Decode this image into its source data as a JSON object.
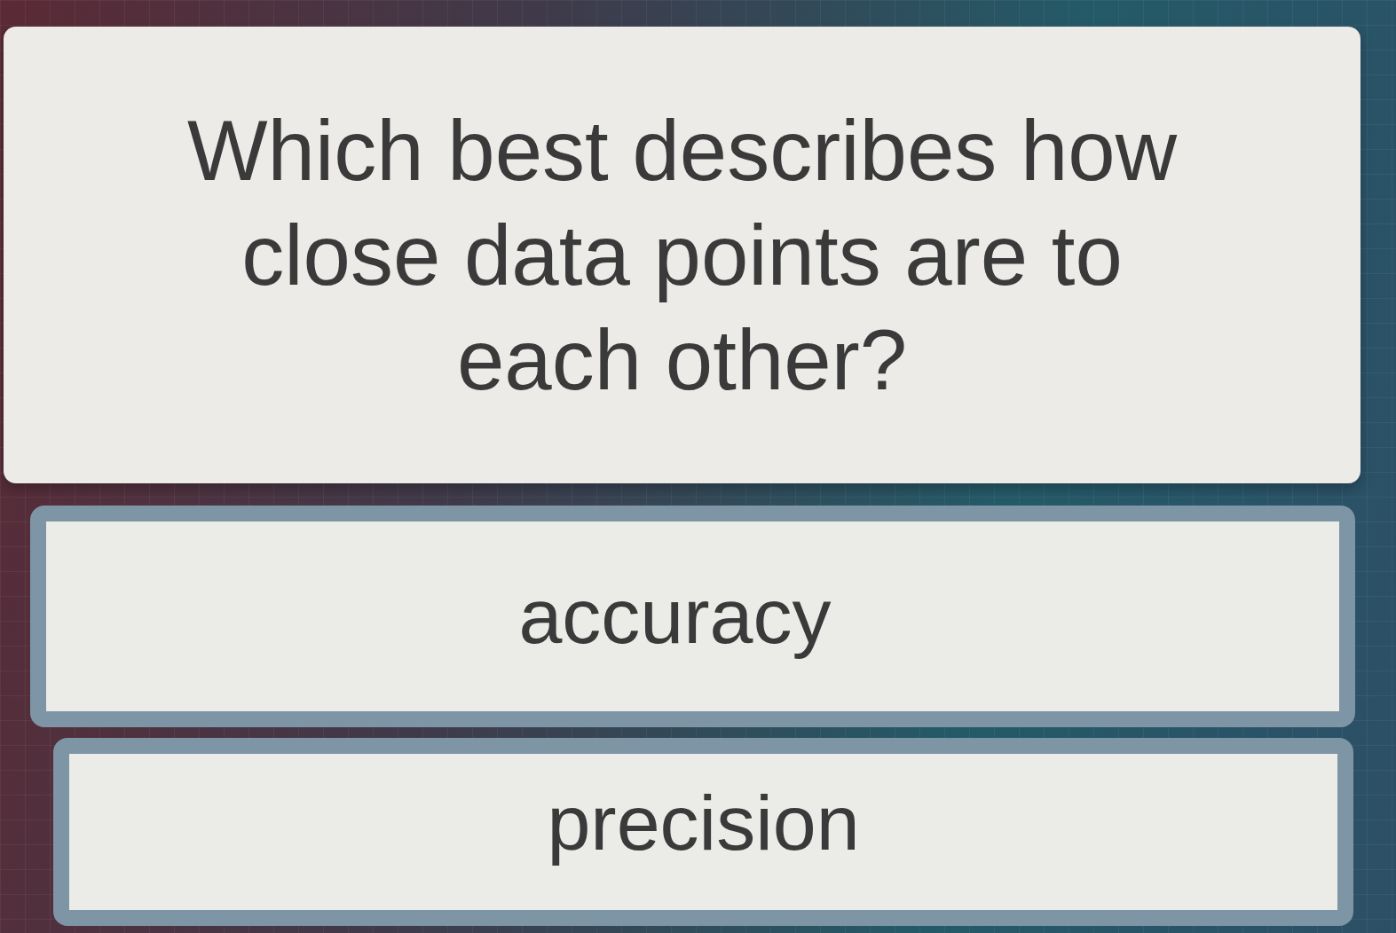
{
  "question": "Which best describes how close data points are to each other?",
  "answers": [
    {
      "label": "accuracy"
    },
    {
      "label": "precision"
    }
  ]
}
